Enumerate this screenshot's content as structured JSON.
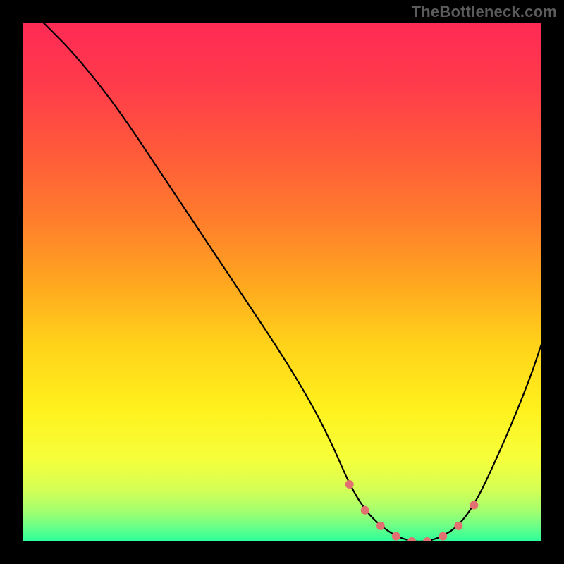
{
  "attribution": "TheBottleneck.com",
  "colors": {
    "bg": "#000000",
    "attribution_text": "#5b5b5b",
    "curve": "#000000",
    "marker_fill": "#e27070",
    "marker_stroke": "#e27070",
    "gradient_stops": [
      {
        "offset": 0.0,
        "color": "#ff2a55"
      },
      {
        "offset": 0.12,
        "color": "#ff3b4b"
      },
      {
        "offset": 0.25,
        "color": "#ff5a3a"
      },
      {
        "offset": 0.38,
        "color": "#ff7d2c"
      },
      {
        "offset": 0.5,
        "color": "#ffa61f"
      },
      {
        "offset": 0.62,
        "color": "#ffd21a"
      },
      {
        "offset": 0.74,
        "color": "#fff01c"
      },
      {
        "offset": 0.84,
        "color": "#f6ff3a"
      },
      {
        "offset": 0.9,
        "color": "#d4ff55"
      },
      {
        "offset": 0.94,
        "color": "#a6ff6e"
      },
      {
        "offset": 0.97,
        "color": "#6dff87"
      },
      {
        "offset": 1.0,
        "color": "#2bff9a"
      }
    ]
  },
  "chart_data": {
    "type": "line",
    "title": "",
    "xlabel": "",
    "ylabel": "",
    "xlim": [
      0,
      100
    ],
    "ylim": [
      0,
      100
    ],
    "grid": false,
    "legend": null,
    "series": [
      {
        "name": "curve",
        "x": [
          4,
          10,
          18,
          26,
          34,
          42,
          50,
          56,
          60,
          63,
          66,
          69,
          72,
          75,
          78,
          81,
          84,
          87,
          90,
          94,
          98,
          100
        ],
        "y": [
          100,
          94,
          84,
          72,
          60,
          48,
          36,
          26,
          18,
          11,
          6,
          3,
          1,
          0,
          0,
          1,
          3,
          7,
          13,
          22,
          32,
          38
        ]
      }
    ],
    "markers": {
      "name": "highlight-points",
      "x": [
        63,
        66,
        69,
        72,
        75,
        78,
        81,
        84,
        87
      ],
      "y": [
        11,
        6,
        3,
        1,
        0,
        0,
        1,
        3,
        7
      ]
    }
  }
}
